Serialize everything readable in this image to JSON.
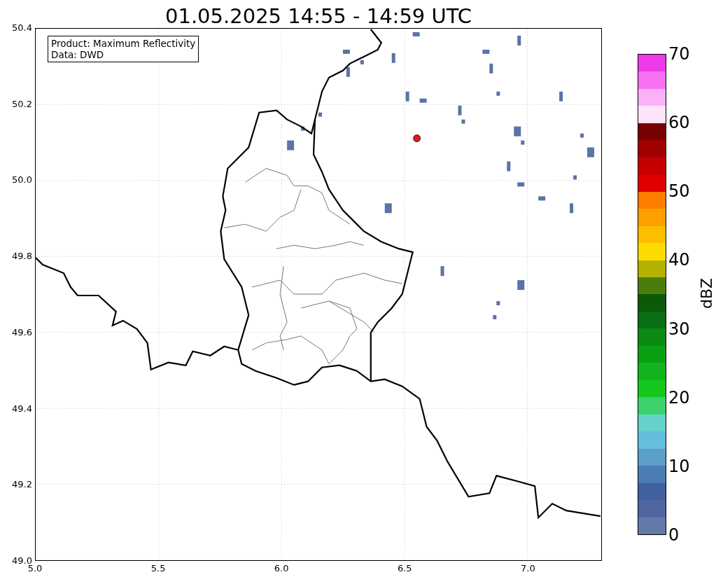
{
  "title": "01.05.2025 14:55 - 14:59 UTC",
  "info_box": [
    "Product: Maximum Reflectivity",
    "Data: DWD"
  ],
  "x_axis": {
    "ticks": [
      "5.0",
      "5.5",
      "6.0",
      "6.5",
      "7.0"
    ]
  },
  "y_axis": {
    "ticks": [
      "50.4",
      "50.2",
      "50.0",
      "49.8",
      "49.6",
      "49.4",
      "49.2",
      "49.0"
    ]
  },
  "colorbar": {
    "label": "dBZ",
    "ticks": [
      "70",
      "60",
      "50",
      "40",
      "30",
      "20",
      "10",
      "0"
    ],
    "segments": [
      {
        "color": "#6478aa"
      },
      {
        "color": "#5066a0"
      },
      {
        "color": "#4160a0"
      },
      {
        "color": "#4b7db4"
      },
      {
        "color": "#5aa0c8"
      },
      {
        "color": "#64bedc"
      },
      {
        "color": "#64d2c8"
      },
      {
        "color": "#3cd26e"
      },
      {
        "color": "#14c81e"
      },
      {
        "color": "#14b41e"
      },
      {
        "color": "#0aa014"
      },
      {
        "color": "#0a8c14"
      },
      {
        "color": "#0a6e14"
      },
      {
        "color": "#0a5a0a"
      },
      {
        "color": "#4b7d0a"
      },
      {
        "color": "#b2b200"
      },
      {
        "color": "#fcdc00"
      },
      {
        "color": "#ffbd00"
      },
      {
        "color": "#ff9f00"
      },
      {
        "color": "#ff7d00"
      },
      {
        "color": "#e10000"
      },
      {
        "color": "#c40000"
      },
      {
        "color": "#a00000"
      },
      {
        "color": "#780000"
      },
      {
        "color": "#fde4fb"
      },
      {
        "color": "#fbb0f7"
      },
      {
        "color": "#f772f2"
      },
      {
        "color": "#ee3ae9"
      }
    ]
  }
}
